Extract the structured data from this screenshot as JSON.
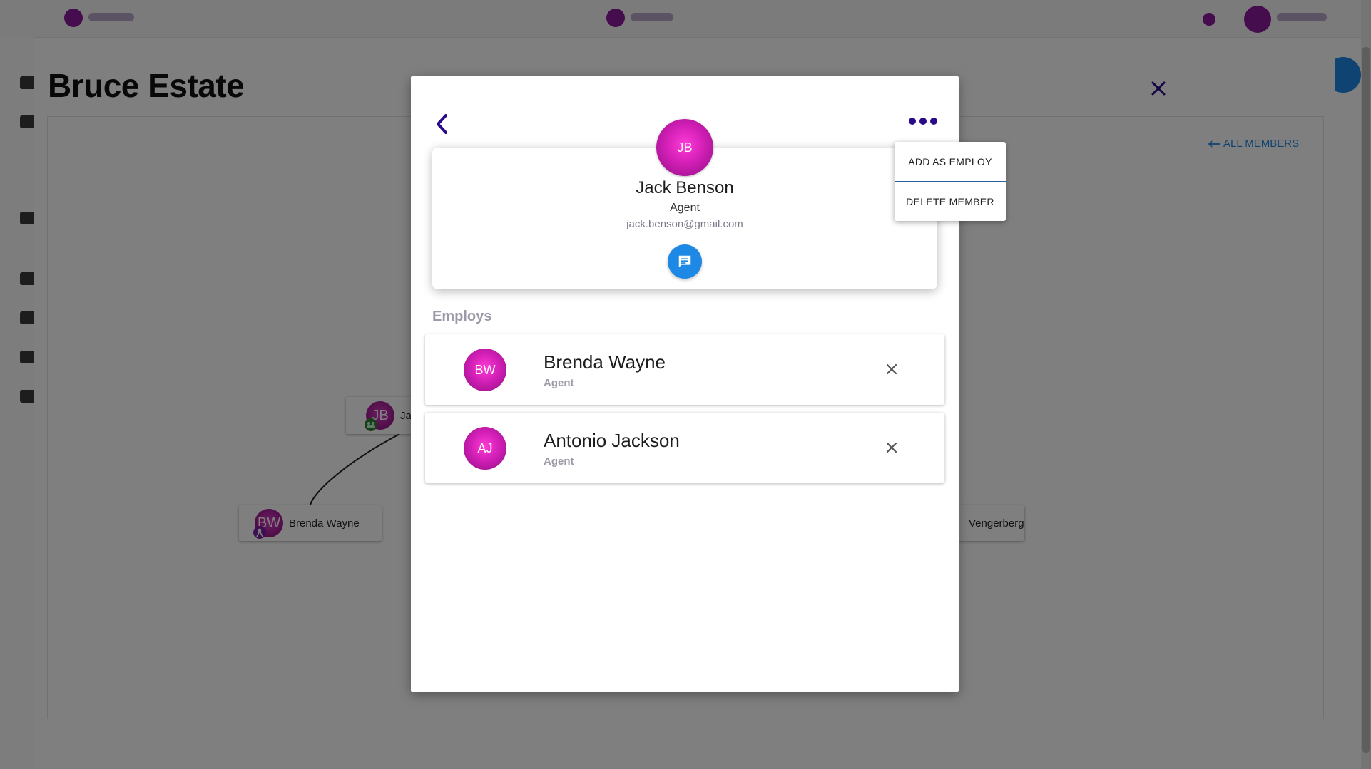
{
  "estate": {
    "title": "Bruce Estate",
    "all_members_label": "ALL MEMBERS",
    "nodes": [
      {
        "initials": "JB",
        "name": "Ja"
      },
      {
        "initials": "BW",
        "name": "Brenda Wayne"
      },
      {
        "initials": "",
        "name": "Vengerberg"
      }
    ]
  },
  "member": {
    "initials": "JB",
    "name": "Jack Benson",
    "role": "Agent",
    "email": "jack.benson@gmail.com",
    "employs_title": "Employs",
    "employs": [
      {
        "initials": "BW",
        "name": "Brenda Wayne",
        "role": "Agent"
      },
      {
        "initials": "AJ",
        "name": "Antonio Jackson",
        "role": "Agent"
      }
    ]
  },
  "menu": {
    "items": [
      "ADD AS EMPLOY",
      "DELETE MEMBER"
    ]
  },
  "colors": {
    "accent": "#1e88e5",
    "nav_icon": "#2a0a8a",
    "avatar": "#d21fb6"
  },
  "icons": {
    "back": "chevron-left-icon",
    "more": "more-horizontal-icon",
    "chat": "chat-icon",
    "remove": "close-icon",
    "close": "close-icon"
  }
}
